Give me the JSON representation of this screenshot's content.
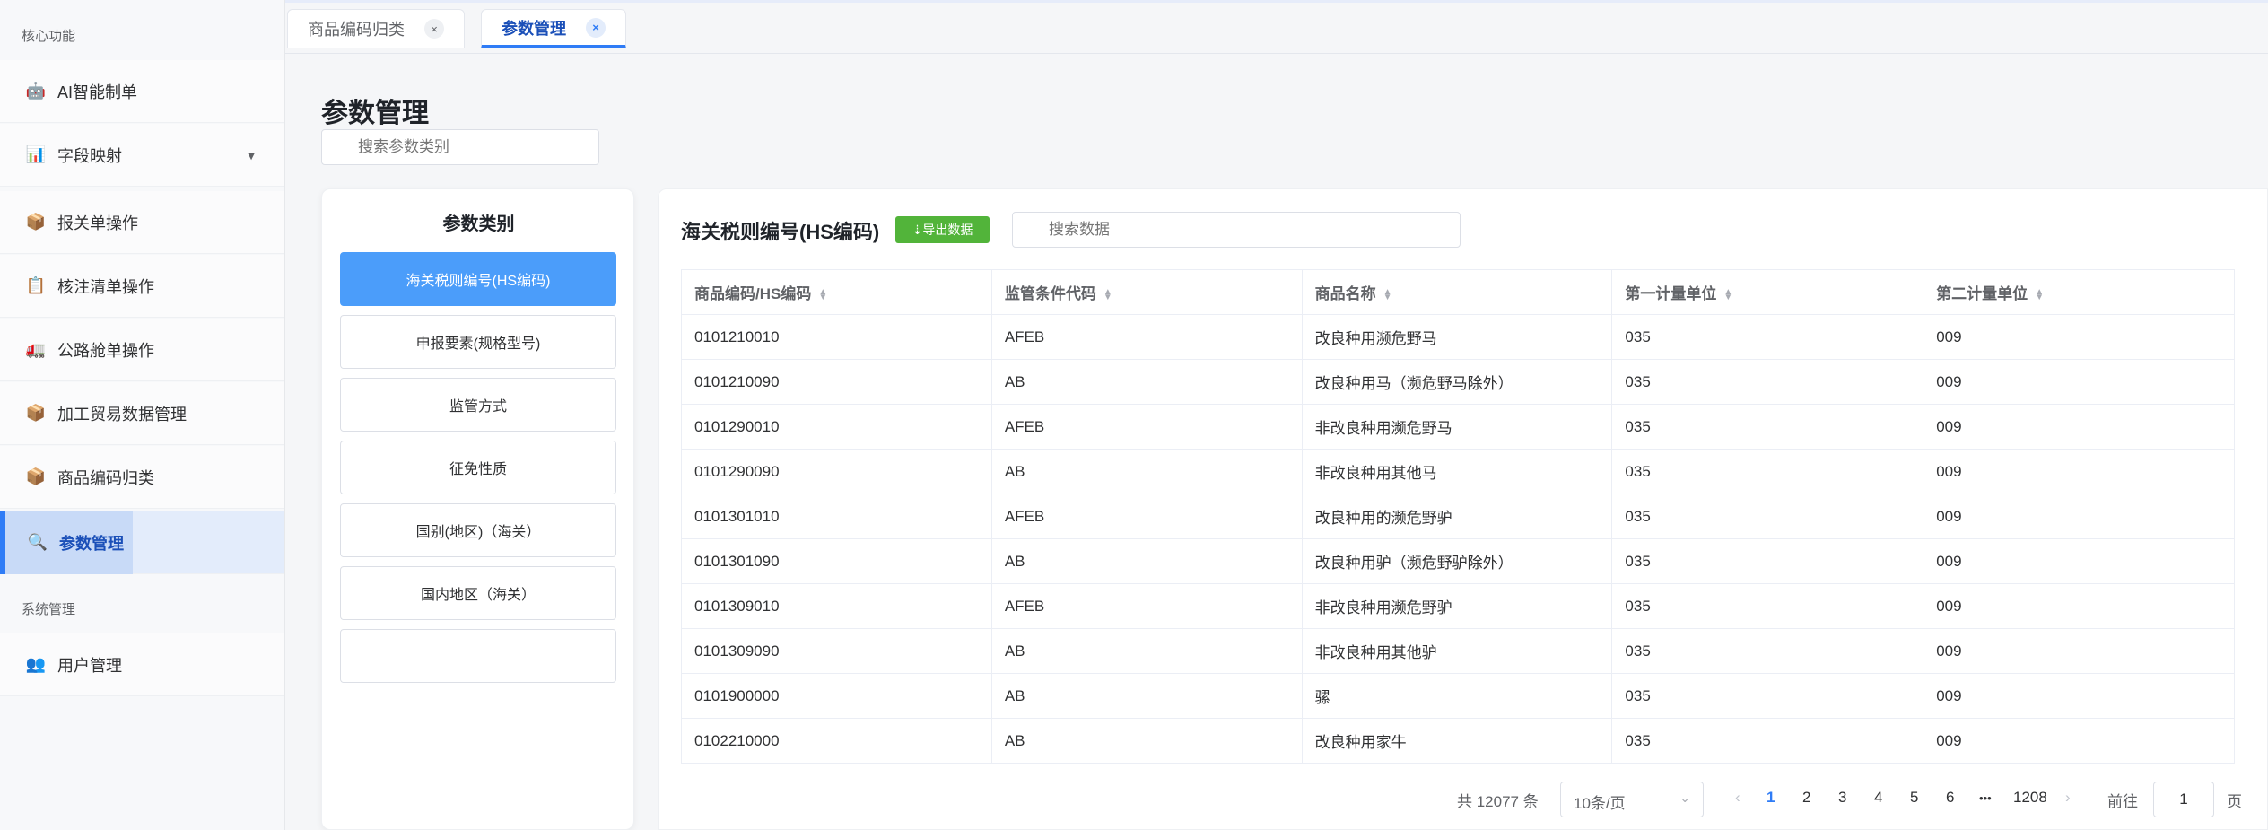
{
  "sidebar": {
    "section_core": "核心功能",
    "section_system": "系统管理",
    "items": [
      {
        "label": "AI智能制单",
        "icon": "🤖"
      },
      {
        "label": "字段映射",
        "icon": "📊",
        "arrow": "▼"
      },
      {
        "label": "报关单操作",
        "icon": "📦"
      },
      {
        "label": "核注清单操作",
        "icon": "📋"
      },
      {
        "label": "公路舱单操作",
        "icon": "🚛"
      },
      {
        "label": "加工贸易数据管理",
        "icon": "📦"
      },
      {
        "label": "商品编码归类",
        "icon": "📦"
      },
      {
        "label": "参数管理",
        "icon": "🔍"
      },
      {
        "label": "用户管理",
        "icon": "👥"
      }
    ]
  },
  "tabs": [
    {
      "label": "商品编码归类",
      "close": "×"
    },
    {
      "label": "参数管理",
      "close": "×"
    }
  ],
  "page": {
    "title": "参数管理",
    "category_search_placeholder": "搜索参数类别"
  },
  "categories": {
    "title": "参数类别",
    "items": [
      "海关税则编号(HS编码)",
      "申报要素(规格型号)",
      "监管方式",
      "征免性质",
      "国别(地区)（海关）",
      "国内地区（海关）",
      ""
    ]
  },
  "data": {
    "title": "海关税则编号(HS编码)",
    "export_label": "⇣导出数据",
    "search_placeholder": "搜索数据",
    "columns": [
      "商品编码/HS编码",
      "监管条件代码",
      "商品名称",
      "第一计量单位",
      "第二计量单位"
    ],
    "rows": [
      [
        "0101210010",
        "AFEB",
        "改良种用濒危野马",
        "035",
        "009"
      ],
      [
        "0101210090",
        "AB",
        "改良种用马（濒危野马除外）",
        "035",
        "009"
      ],
      [
        "0101290010",
        "AFEB",
        "非改良种用濒危野马",
        "035",
        "009"
      ],
      [
        "0101290090",
        "AB",
        "非改良种用其他马",
        "035",
        "009"
      ],
      [
        "0101301010",
        "AFEB",
        "改良种用的濒危野驴",
        "035",
        "009"
      ],
      [
        "0101301090",
        "AB",
        "改良种用驴（濒危野驴除外）",
        "035",
        "009"
      ],
      [
        "0101309010",
        "AFEB",
        "非改良种用濒危野驴",
        "035",
        "009"
      ],
      [
        "0101309090",
        "AB",
        "非改良种用其他驴",
        "035",
        "009"
      ],
      [
        "0101900000",
        "AB",
        "骡",
        "035",
        "009"
      ],
      [
        "0102210000",
        "AB",
        "改良种用家牛",
        "035",
        "009"
      ]
    ]
  },
  "pagination": {
    "total": "共 12077 条",
    "page_size": "10条/页",
    "prev": "‹",
    "next": "›",
    "pages": [
      "1",
      "2",
      "3",
      "4",
      "5",
      "6",
      "•••",
      "1208"
    ],
    "current": "1",
    "goto_label": "前往",
    "goto_value": "1",
    "page_suffix": "页"
  },
  "colors": {
    "accent": "#2f7cf6",
    "export": "#52b43a",
    "category_active": "#4b9dfa"
  }
}
